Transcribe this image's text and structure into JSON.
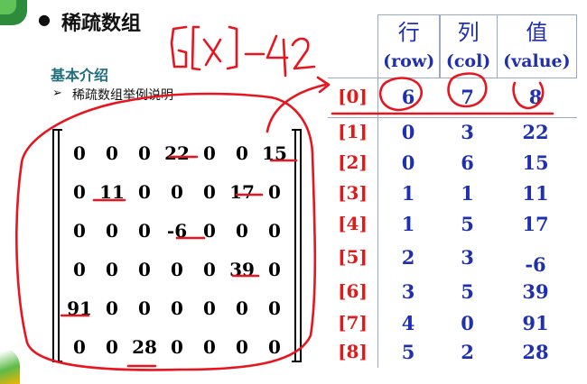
{
  "header": {
    "bullet": "●",
    "title": "稀疏数组"
  },
  "section": {
    "subtitle": "基本介绍",
    "item_arrow": "➢",
    "item_text": "稀疏数组举例说明"
  },
  "annotation": {
    "handwritten_note": "6 x] -42",
    "ink_color": "#e8141e"
  },
  "matrix": {
    "rows": [
      [
        "0",
        "0",
        "0",
        "22",
        "0",
        "0",
        "15"
      ],
      [
        "0",
        "11",
        "0",
        "0",
        "0",
        "17",
        "0"
      ],
      [
        "0",
        "0",
        "0",
        "-6",
        "0",
        "0",
        "0"
      ],
      [
        "0",
        "0",
        "0",
        "0",
        "0",
        "39",
        "0"
      ],
      [
        "91",
        "0",
        "0",
        "0",
        "0",
        "0",
        "0"
      ],
      [
        "0",
        "0",
        "28",
        "0",
        "0",
        "0",
        "0"
      ]
    ]
  },
  "sparse_table": {
    "headers": [
      {
        "cn": "行",
        "en": "(row)"
      },
      {
        "cn": "列",
        "en": "(col)"
      },
      {
        "cn": "值",
        "en": "(value)"
      }
    ],
    "rows": [
      {
        "index": "[0]",
        "row": "6",
        "col": "7",
        "value": "8"
      },
      {
        "index": "[1]",
        "row": "0",
        "col": "3",
        "value": "22"
      },
      {
        "index": "[2]",
        "row": "0",
        "col": "6",
        "value": "15"
      },
      {
        "index": "[3]",
        "row": "1",
        "col": "1",
        "value": "11"
      },
      {
        "index": "[4]",
        "row": "1",
        "col": "5",
        "value": "17"
      },
      {
        "index": "[5]",
        "row": "2",
        "col": "3",
        "value": "-6"
      },
      {
        "index": "[6]",
        "row": "3",
        "col": "5",
        "value": "39"
      },
      {
        "index": "[7]",
        "row": "4",
        "col": "0",
        "value": "91"
      },
      {
        "index": "[8]",
        "row": "5",
        "col": "2",
        "value": "28"
      }
    ],
    "colors": {
      "index": "#e01a1a",
      "values": "#1e2fb0",
      "grid": "#9aa8c4"
    }
  }
}
